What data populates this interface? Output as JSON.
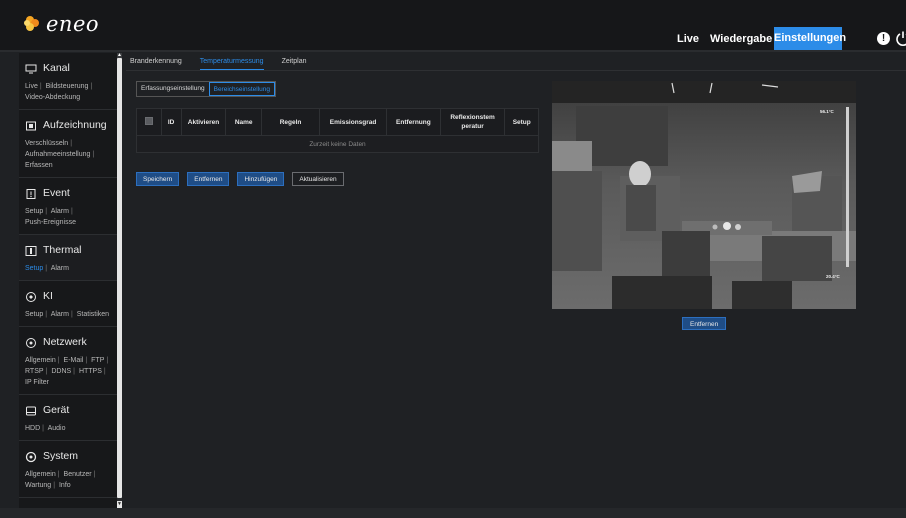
{
  "brand": {
    "logo_text": "eneo",
    "accent": "#2c8ce8"
  },
  "nav": {
    "live": "Live",
    "playback": "Wiedergabe",
    "settings": "Einstellungen",
    "info_icon": "info-icon",
    "power_icon": "power-icon"
  },
  "sidebar": {
    "sections": [
      {
        "title": "Kanal",
        "icon": "monitor-icon",
        "links": [
          "Live",
          "Bildsteuerung",
          "Video-Abdeckung"
        ]
      },
      {
        "title": "Aufzeichnung",
        "icon": "record-icon",
        "links": [
          "Verschlüsseln",
          "Aufnahmeeinstellung",
          "Erfassen"
        ]
      },
      {
        "title": "Event",
        "icon": "event-icon",
        "links": [
          "Setup",
          "Alarm",
          "Push-Ereignisse"
        ]
      },
      {
        "title": "Thermal",
        "icon": "thermal-icon",
        "links": [
          "Setup",
          "Alarm"
        ],
        "active_link": 0
      },
      {
        "title": "KI",
        "icon": "ai-icon",
        "links": [
          "Setup",
          "Alarm",
          "Statistiken"
        ]
      },
      {
        "title": "Netzwerk",
        "icon": "network-icon",
        "links": [
          "Allgemein",
          "E-Mail",
          "FTP",
          "RTSP",
          "DDNS",
          "HTTPS",
          "IP Filter"
        ]
      },
      {
        "title": "Gerät",
        "icon": "device-icon",
        "links": [
          "HDD",
          "Audio"
        ]
      },
      {
        "title": "System",
        "icon": "system-icon",
        "links": [
          "Allgemein",
          "Benutzer",
          "Wartung",
          "Info"
        ]
      }
    ]
  },
  "tabs": [
    "Branderkennung",
    "Temperaturmessung",
    "Zeitplan"
  ],
  "active_tab": 1,
  "subtabs": [
    "Erfassungseinstellung",
    "Bereichseinstellung"
  ],
  "active_subtab": 1,
  "table": {
    "headers": [
      "",
      "ID",
      "Aktivieren",
      "Name",
      "Regeln",
      "Emissionsgrad",
      "Entfernung",
      "Reflexionstem\nperatur",
      "Setup"
    ],
    "empty_text": "Zurzeit keine Daten"
  },
  "buttons": {
    "save": "Speichern",
    "remove": "Entfernen",
    "add": "Hinzufügen",
    "refresh": "Aktualisieren"
  },
  "preview": {
    "temp_high": "56.1°C",
    "temp_low": "20.4°C",
    "remove_button": "Entfernen"
  }
}
